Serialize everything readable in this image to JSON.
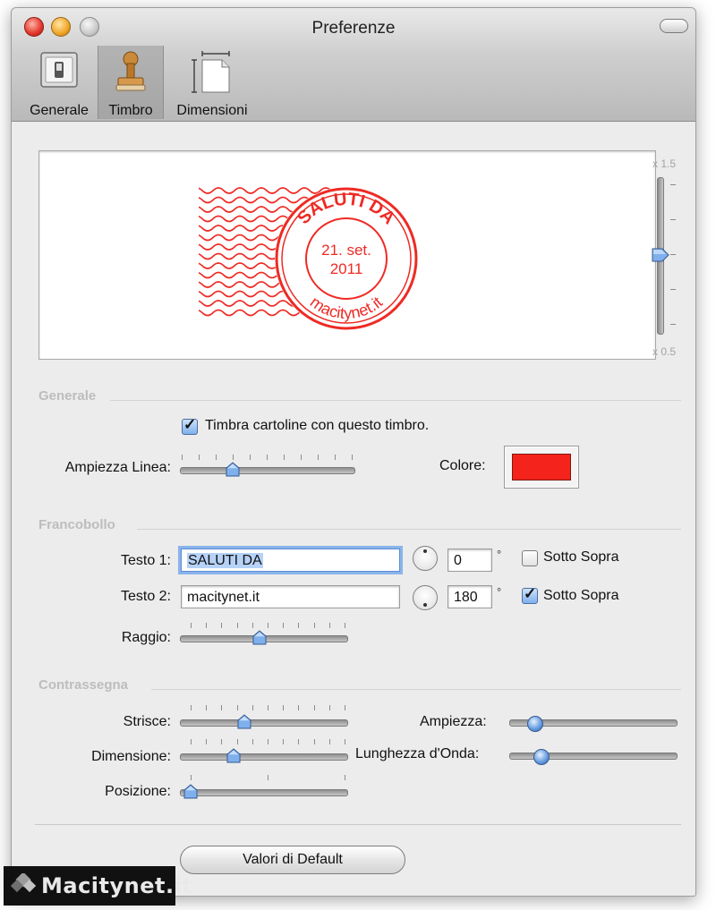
{
  "window": {
    "title": "Preferenze"
  },
  "toolbar": {
    "items": [
      {
        "label": "Generale",
        "icon": "switch-icon",
        "selected": false
      },
      {
        "label": "Timbro",
        "icon": "stamp-icon",
        "selected": true
      },
      {
        "label": "Dimensioni",
        "icon": "page-size-icon",
        "selected": false
      }
    ]
  },
  "preview": {
    "stamp_top_text": "SALUTI DA",
    "stamp_date_line1": "21. set.",
    "stamp_date_line2": "2011",
    "stamp_bottom_text": "macitynet.it",
    "stamp_color": "#ee2a24",
    "zoom_max": "x 1.5",
    "zoom_min": "x 0.5",
    "zoom_level": 0.5
  },
  "generale": {
    "section_title": "Generale",
    "stamp_checkbox_label": "Timbra cartoline con questo timbro.",
    "stamp_checked": true,
    "line_width_label": "Ampiezza Linea:",
    "line_width_value": 0.3,
    "color_label": "Colore:",
    "color_value": "#f4231b"
  },
  "francobollo": {
    "section_title": "Francobollo",
    "text1_label": "Testo 1:",
    "text1_value": "SALUTI DA",
    "angle1_value": "0",
    "flip1_label": "Sotto Sopra",
    "flip1_checked": false,
    "text2_label": "Testo 2:",
    "text2_value": "macitynet.it",
    "angle2_value": "180",
    "flip2_label": "Sotto Sopra",
    "flip2_checked": true,
    "degree_symbol": "°",
    "radius_label": "Raggio:",
    "radius_value": 0.45
  },
  "contrassegna": {
    "section_title": "Contrassegna",
    "stripes_label": "Strisce:",
    "stripes_value": 0.35,
    "amplitude_label": "Ampiezza:",
    "amplitude_value": 0.1,
    "size_label": "Dimensione:",
    "size_value": 0.28,
    "wavelength_label": "Lunghezza d'Onda:",
    "wavelength_value": 0.14,
    "position_label": "Posizione:",
    "position_value": 0.0
  },
  "footer": {
    "default_button": "Valori di Default"
  },
  "watermark": {
    "text": "Macitynet.it"
  }
}
